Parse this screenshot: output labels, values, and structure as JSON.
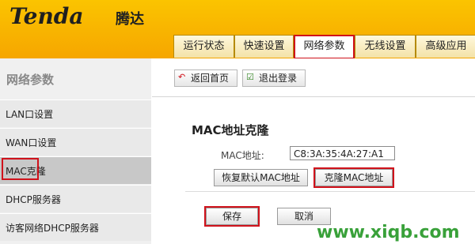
{
  "header": {
    "logo": "Tenda",
    "logo_cn": "腾达",
    "tabs": [
      {
        "label": "运行状态"
      },
      {
        "label": "快速设置"
      },
      {
        "label": "网络参数"
      },
      {
        "label": "无线设置"
      },
      {
        "label": "高级应用"
      }
    ]
  },
  "sidebar": {
    "title": "网络参数",
    "items": [
      {
        "label": "LAN口设置"
      },
      {
        "label": "WAN口设置"
      },
      {
        "label": "MAC克隆"
      },
      {
        "label": "DHCP服务器"
      },
      {
        "label": "访客网络DHCP服务器"
      }
    ]
  },
  "toolbar": {
    "home_label": "返回首页",
    "logout_label": "退出登录"
  },
  "main": {
    "section_title": "MAC地址克隆",
    "mac_label": "MAC地址:",
    "mac_value": "C8:3A:35:4A:27:A1",
    "restore_button": "恢复默认MAC地址",
    "clone_button": "克隆MAC地址",
    "save_button": "保存",
    "cancel_button": "取消"
  },
  "watermark": "www.xiqb.com",
  "colors": {
    "header_yellow": "#f6a600",
    "highlight_red": "#d0121b",
    "watermark_green": "#39a13a"
  }
}
